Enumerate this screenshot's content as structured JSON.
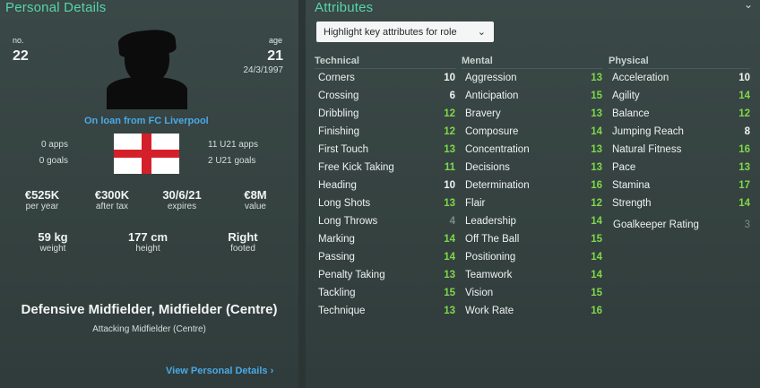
{
  "personal": {
    "title": "Personal Details",
    "number_label": "no.",
    "number": "22",
    "age_label": "age",
    "age": "21",
    "dob": "24/3/1997",
    "loan_text": "On loan from FC Liverpool",
    "apps": "0 apps",
    "goals": "0 goals",
    "u21_apps": "11 U21 apps",
    "u21_goals": "2 U21 goals",
    "stats": [
      {
        "value": "€525K",
        "label": "per year"
      },
      {
        "value": "€300K",
        "label": "after tax"
      },
      {
        "value": "30/6/21",
        "label": "expires"
      },
      {
        "value": "€8M",
        "label": "value"
      }
    ],
    "physique": [
      {
        "value": "59 kg",
        "label": "weight"
      },
      {
        "value": "177 cm",
        "label": "height"
      },
      {
        "value": "Right",
        "label": "footed"
      }
    ],
    "position_main": "Defensive Midfielder, Midfielder (Centre)",
    "position_alt": "Attacking Midfielder (Centre)",
    "view_link": "View Personal Details",
    "flag": "england-flag"
  },
  "attributes": {
    "title": "Attributes",
    "dropdown": "Highlight key attributes for role",
    "colors": {
      "green": "#7fd84a",
      "dim": "#7d8b89",
      "white": "#f1f4f3"
    },
    "technical_title": "Technical",
    "mental_title": "Mental",
    "physical_title": "Physical",
    "technical": [
      {
        "name": "Corners",
        "value": "10",
        "tone": "white"
      },
      {
        "name": "Crossing",
        "value": "6",
        "tone": "white"
      },
      {
        "name": "Dribbling",
        "value": "12",
        "tone": "green"
      },
      {
        "name": "Finishing",
        "value": "12",
        "tone": "green"
      },
      {
        "name": "First Touch",
        "value": "13",
        "tone": "green"
      },
      {
        "name": "Free Kick Taking",
        "value": "11",
        "tone": "green"
      },
      {
        "name": "Heading",
        "value": "10",
        "tone": "white"
      },
      {
        "name": "Long Shots",
        "value": "13",
        "tone": "green"
      },
      {
        "name": "Long Throws",
        "value": "4",
        "tone": "dim"
      },
      {
        "name": "Marking",
        "value": "14",
        "tone": "green"
      },
      {
        "name": "Passing",
        "value": "14",
        "tone": "green"
      },
      {
        "name": "Penalty Taking",
        "value": "13",
        "tone": "green"
      },
      {
        "name": "Tackling",
        "value": "15",
        "tone": "green"
      },
      {
        "name": "Technique",
        "value": "13",
        "tone": "green"
      }
    ],
    "mental": [
      {
        "name": "Aggression",
        "value": "13",
        "tone": "green"
      },
      {
        "name": "Anticipation",
        "value": "15",
        "tone": "green"
      },
      {
        "name": "Bravery",
        "value": "13",
        "tone": "green"
      },
      {
        "name": "Composure",
        "value": "14",
        "tone": "green"
      },
      {
        "name": "Concentration",
        "value": "13",
        "tone": "green"
      },
      {
        "name": "Decisions",
        "value": "13",
        "tone": "green"
      },
      {
        "name": "Determination",
        "value": "16",
        "tone": "green"
      },
      {
        "name": "Flair",
        "value": "12",
        "tone": "green"
      },
      {
        "name": "Leadership",
        "value": "14",
        "tone": "green"
      },
      {
        "name": "Off The Ball",
        "value": "15",
        "tone": "green"
      },
      {
        "name": "Positioning",
        "value": "14",
        "tone": "green"
      },
      {
        "name": "Teamwork",
        "value": "14",
        "tone": "green"
      },
      {
        "name": "Vision",
        "value": "15",
        "tone": "green"
      },
      {
        "name": "Work Rate",
        "value": "16",
        "tone": "green"
      }
    ],
    "physical": [
      {
        "name": "Acceleration",
        "value": "10",
        "tone": "white"
      },
      {
        "name": "Agility",
        "value": "14",
        "tone": "green"
      },
      {
        "name": "Balance",
        "value": "12",
        "tone": "green"
      },
      {
        "name": "Jumping Reach",
        "value": "8",
        "tone": "white"
      },
      {
        "name": "Natural Fitness",
        "value": "16",
        "tone": "green"
      },
      {
        "name": "Pace",
        "value": "13",
        "tone": "green"
      },
      {
        "name": "Stamina",
        "value": "17",
        "tone": "green"
      },
      {
        "name": "Strength",
        "value": "14",
        "tone": "green"
      }
    ],
    "goalkeeper": {
      "name": "Goalkeeper Rating",
      "value": "3",
      "tone": "dim"
    }
  }
}
